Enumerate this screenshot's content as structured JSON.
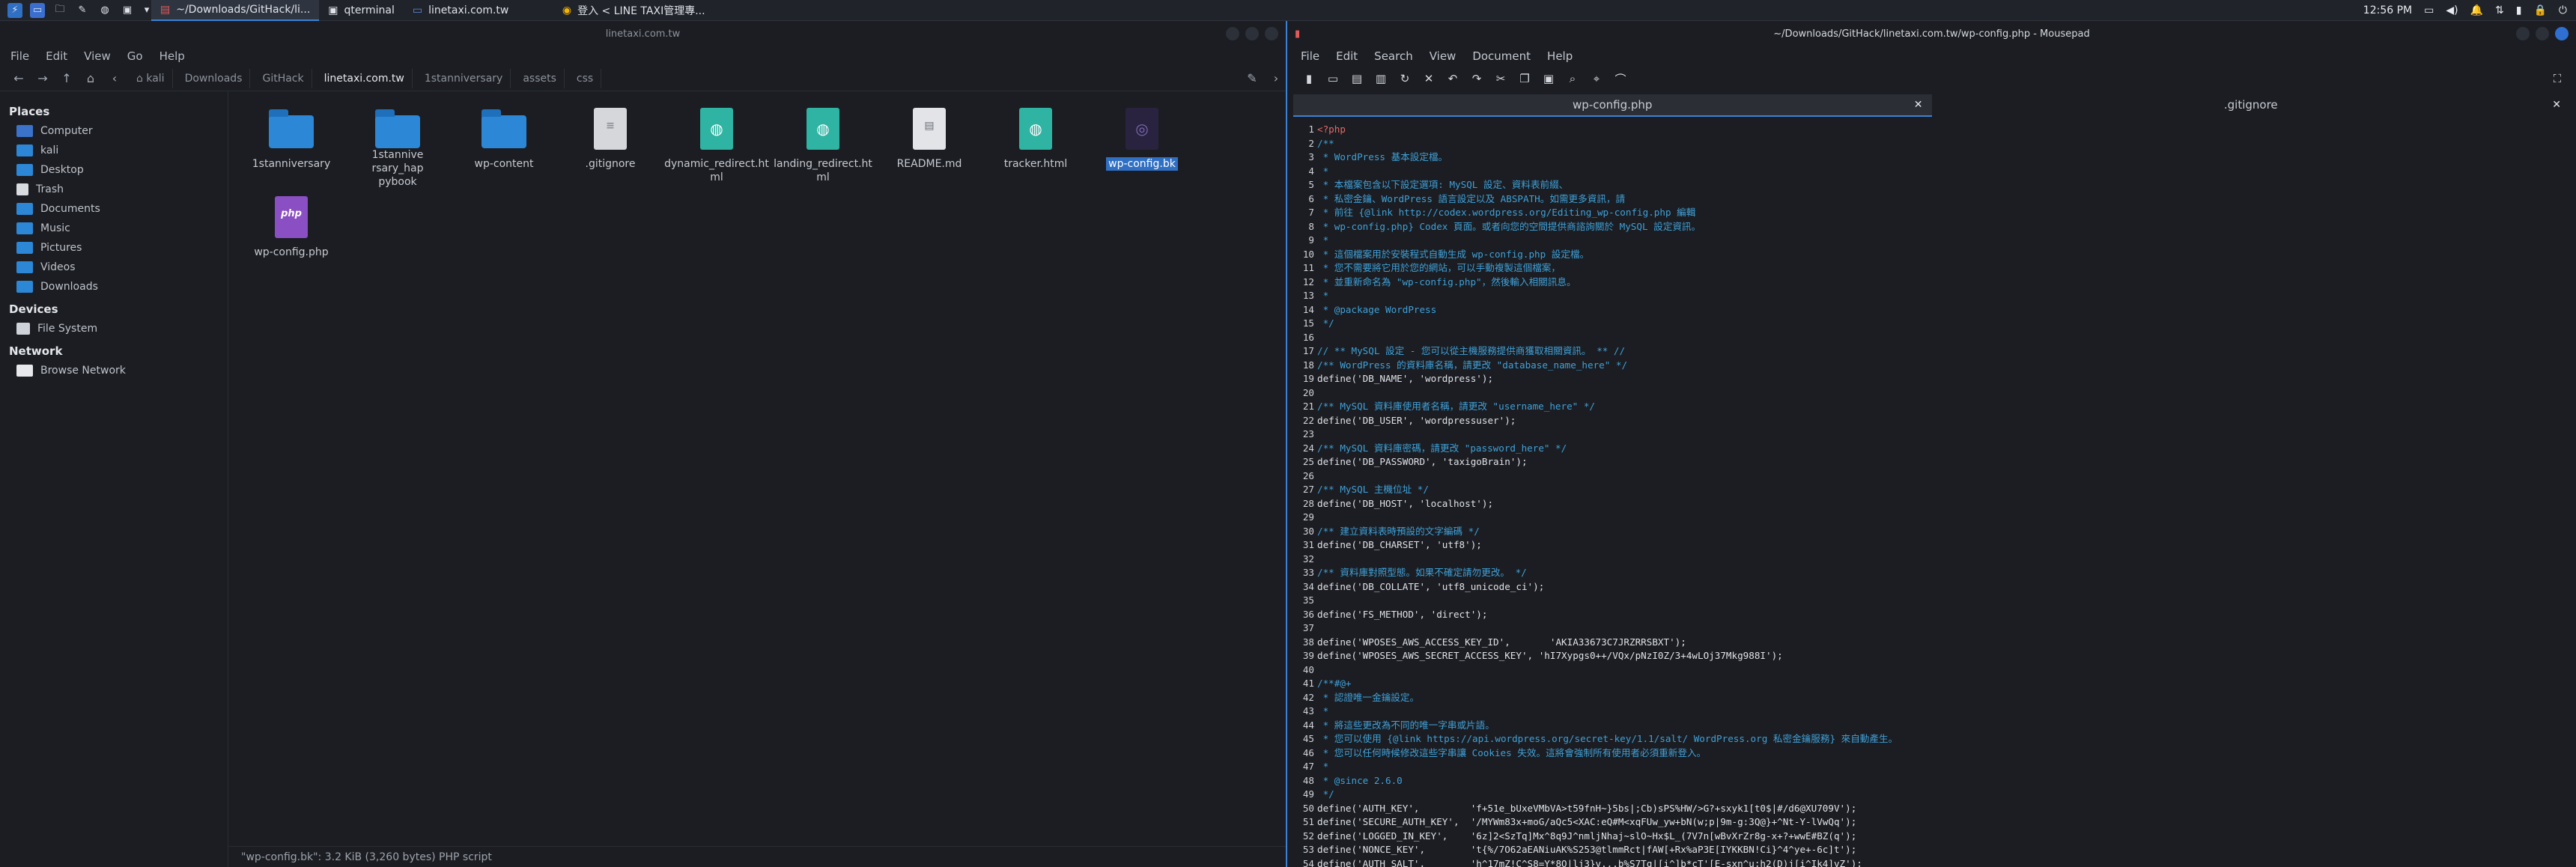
{
  "taskbar": {
    "tasks": [
      {
        "label": "~/Downloads/GitHack/li...",
        "active": true
      },
      {
        "label": "qterminal",
        "active": false
      },
      {
        "label": "linetaxi.com.tw",
        "active": false
      },
      {
        "label": "登入 < LINE TAXI管理專...",
        "active": false
      }
    ],
    "clock": "12:56 PM"
  },
  "filemanager": {
    "title": "linetaxi.com.tw",
    "menu": [
      "File",
      "Edit",
      "View",
      "Go",
      "Help"
    ],
    "breadcrumbs": [
      "kali",
      "Downloads",
      "GitHack",
      "linetaxi.com.tw",
      "1stanniversary",
      "assets",
      "css"
    ],
    "sidebar": {
      "places_header": "Places",
      "places": [
        "Computer",
        "kali",
        "Desktop",
        "Trash",
        "Documents",
        "Music",
        "Pictures",
        "Videos",
        "Downloads"
      ],
      "devices_header": "Devices",
      "devices": [
        "File System"
      ],
      "network_header": "Network",
      "network": [
        "Browse Network"
      ]
    },
    "files": [
      {
        "name": "1stanniversary",
        "kind": "folder"
      },
      {
        "name": "1stanniversary_happybook",
        "kind": "folder"
      },
      {
        "name": "wp-content",
        "kind": "folder"
      },
      {
        "name": ".gitignore",
        "kind": "text"
      },
      {
        "name": "dynamic_redirect.html",
        "kind": "html"
      },
      {
        "name": "landing_redirect.html",
        "kind": "html"
      },
      {
        "name": "README.md",
        "kind": "md"
      },
      {
        "name": "tracker.html",
        "kind": "html"
      },
      {
        "name": "wp-config.bk",
        "kind": "bk"
      },
      {
        "name": "wp-config.php",
        "kind": "php"
      }
    ],
    "status": "\"wp-config.bk\": 3.2 KiB (3,260 bytes) PHP script"
  },
  "editor": {
    "title": "~/Downloads/GitHack/linetaxi.com.tw/wp-config.php - Mousepad",
    "menu": [
      "File",
      "Edit",
      "Search",
      "View",
      "Document",
      "Help"
    ],
    "tabs": [
      {
        "label": "wp-config.php",
        "active": true
      },
      {
        "label": ".gitignore",
        "active": false
      }
    ],
    "lines": [
      {
        "n": "1",
        "t": "<?php",
        "c": "tag"
      },
      {
        "n": "2",
        "t": "/**",
        "c": "com"
      },
      {
        "n": "3",
        "t": " * WordPress 基本設定檔。",
        "c": "com"
      },
      {
        "n": "4",
        "t": " *",
        "c": "com"
      },
      {
        "n": "5",
        "t": " * 本檔案包含以下設定選項: MySQL 設定、資料表前綴、",
        "c": "com"
      },
      {
        "n": "6",
        "t": " * 私密金鑰、WordPress 語言設定以及 ABSPATH。如需更多資訊，請",
        "c": "com"
      },
      {
        "n": "7",
        "t": " * 前往 {@link http://codex.wordpress.org/Editing_wp-config.php 編輯",
        "c": "com"
      },
      {
        "n": "8",
        "t": " * wp-config.php} Codex 頁面。或者向您的空間提供商諮詢關於 MySQL 設定資訊。",
        "c": "com"
      },
      {
        "n": "9",
        "t": " *",
        "c": "com"
      },
      {
        "n": "10",
        "t": " * 這個檔案用於安裝程式自動生成 wp-config.php 設定檔。",
        "c": "com"
      },
      {
        "n": "11",
        "t": " * 您不需要將它用於您的網站，可以手動複製這個檔案，",
        "c": "com"
      },
      {
        "n": "12",
        "t": " * 並重新命名為 \"wp-config.php\"，然後輸入相關訊息。",
        "c": "com"
      },
      {
        "n": "13",
        "t": " *",
        "c": "com"
      },
      {
        "n": "14",
        "t": " * @package WordPress",
        "c": "com"
      },
      {
        "n": "15",
        "t": " */",
        "c": "com"
      },
      {
        "n": "16",
        "t": "",
        "c": "def"
      },
      {
        "n": "17",
        "t": "// ** MySQL 設定 - 您可以從主機服務提供商獲取相關資訊。 ** //",
        "c": "com"
      },
      {
        "n": "18",
        "t": "/** WordPress 的資料庫名稱，請更改 \"database_name_here\" */",
        "c": "com"
      },
      {
        "n": "19",
        "t": "define('DB_NAME', 'wordpress');",
        "c": "def"
      },
      {
        "n": "20",
        "t": "",
        "c": "def"
      },
      {
        "n": "21",
        "t": "/** MySQL 資料庫使用者名稱，請更改 \"username_here\" */",
        "c": "com"
      },
      {
        "n": "22",
        "t": "define('DB_USER', 'wordpressuser');",
        "c": "def"
      },
      {
        "n": "23",
        "t": "",
        "c": "def"
      },
      {
        "n": "24",
        "t": "/** MySQL 資料庫密碼，請更改 \"password_here\" */",
        "c": "com"
      },
      {
        "n": "25",
        "t": "define('DB_PASSWORD', 'taxigoBrain');",
        "c": "def"
      },
      {
        "n": "26",
        "t": "",
        "c": "def"
      },
      {
        "n": "27",
        "t": "/** MySQL 主機位址 */",
        "c": "com"
      },
      {
        "n": "28",
        "t": "define('DB_HOST', 'localhost');",
        "c": "def"
      },
      {
        "n": "29",
        "t": "",
        "c": "def"
      },
      {
        "n": "30",
        "t": "/** 建立資料表時預設的文字編碼 */",
        "c": "com"
      },
      {
        "n": "31",
        "t": "define('DB_CHARSET', 'utf8');",
        "c": "def"
      },
      {
        "n": "32",
        "t": "",
        "c": "def"
      },
      {
        "n": "33",
        "t": "/** 資料庫對照型態。如果不確定請勿更改。 */",
        "c": "com"
      },
      {
        "n": "34",
        "t": "define('DB_COLLATE', 'utf8_unicode_ci');",
        "c": "def"
      },
      {
        "n": "35",
        "t": "",
        "c": "def"
      },
      {
        "n": "36",
        "t": "define('FS_METHOD', 'direct');",
        "c": "def"
      },
      {
        "n": "37",
        "t": "",
        "c": "def"
      },
      {
        "n": "38",
        "t": "define('WPOSES_AWS_ACCESS_KEY_ID',       'AKIA33673C7JRZRRSBXT');",
        "c": "def"
      },
      {
        "n": "39",
        "t": "define('WPOSES_AWS_SECRET_ACCESS_KEY', 'hI7Xypgs0++/VQx/pNzI0Z/3+4wLOj37Mkg988I');",
        "c": "def"
      },
      {
        "n": "40",
        "t": "",
        "c": "def"
      },
      {
        "n": "41",
        "t": "/**#@+",
        "c": "com"
      },
      {
        "n": "42",
        "t": " * 認證唯一金鑰設定。",
        "c": "com"
      },
      {
        "n": "43",
        "t": " *",
        "c": "com"
      },
      {
        "n": "44",
        "t": " * 將這些更改為不同的唯一字串或片語。",
        "c": "com"
      },
      {
        "n": "45",
        "t": " * 您可以使用 {@link https://api.wordpress.org/secret-key/1.1/salt/ WordPress.org 私密金鑰服務} 來自動產生。",
        "c": "com"
      },
      {
        "n": "46",
        "t": " * 您可以任何時候修改這些字串讓 Cookies 失效。這將會強制所有使用者必須重新登入。",
        "c": "com"
      },
      {
        "n": "47",
        "t": " *",
        "c": "com"
      },
      {
        "n": "48",
        "t": " * @since 2.6.0",
        "c": "com"
      },
      {
        "n": "49",
        "t": " */",
        "c": "com"
      },
      {
        "n": "50",
        "t": "define('AUTH_KEY',         'f+51e_bUxeVMbVA>t59fnH~}5bs|;Cb)sPS%HW/>G?+sxyk1[t0$|#/d6@XU709V');",
        "c": "def"
      },
      {
        "n": "51",
        "t": "define('SECURE_AUTH_KEY',  '/MYWm83x+moG/aQc5<XAC:eQ#M<xqFUw_yw+bN(w;p|9m-g:3Q@}+^Nt-Y-lVwQq');",
        "c": "def"
      },
      {
        "n": "52",
        "t": "define('LOGGED_IN_KEY',    '6z]2<SzTq]Mx^8q9J^nmljNhaj~slO~Hx$L_(7V7n[wBvXrZr8g-x+?+wwE#BZ(q');",
        "c": "def"
      },
      {
        "n": "53",
        "t": "define('NONCE_KEY',        't{%/7O62aEANiuAK%S253@tlmmRct|fAW[+Rx%aP3E[IYKKBN!Ci}^4^ye+-6c]t');",
        "c": "def"
      },
      {
        "n": "54",
        "t": "define('AUTH_SALT',        'h^17mZ!C^S8=Y*8O|lj3}v...b%S7Tq|[i^]b*cT'[E-sxn^u;h2(D)j[i^Ik4]vZ');",
        "c": "def"
      }
    ]
  }
}
